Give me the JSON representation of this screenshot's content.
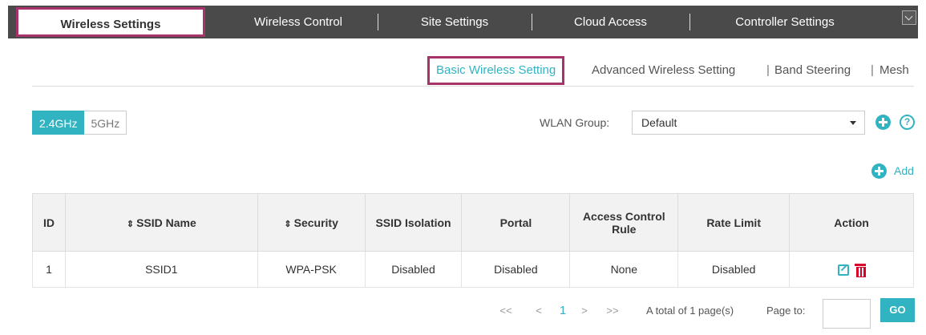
{
  "topnav": {
    "tabs": [
      {
        "label": "Wireless Settings",
        "active": true
      },
      {
        "label": "Wireless Control"
      },
      {
        "label": "Site Settings"
      },
      {
        "label": "Cloud Access"
      },
      {
        "label": "Controller Settings"
      }
    ]
  },
  "subnav": {
    "items": [
      {
        "label": "Basic Wireless Setting",
        "active": true
      },
      {
        "label": "Advanced Wireless Setting"
      },
      {
        "label": "Band Steering"
      },
      {
        "label": "Mesh"
      }
    ],
    "separator": "|"
  },
  "band": {
    "options": [
      "2.4GHz",
      "5GHz"
    ],
    "selected": "2.4GHz"
  },
  "wlan_group": {
    "label": "WLAN Group:",
    "value": "Default"
  },
  "add_label": "Add",
  "help_glyph": "?",
  "table": {
    "headers": {
      "id": "ID",
      "ssid": "SSID Name",
      "security": "Security",
      "isolation": "SSID Isolation",
      "portal": "Portal",
      "acl": "Access Control Rule",
      "rate": "Rate Limit",
      "action": "Action"
    },
    "sort_glyph": "⇕",
    "rows": [
      {
        "id": "1",
        "ssid": "SSID1",
        "security": "WPA-PSK",
        "isolation": "Disabled",
        "portal": "Disabled",
        "acl": "None",
        "rate": "Disabled"
      }
    ]
  },
  "pagination": {
    "first": "<<",
    "prev": "<",
    "current": "1",
    "next": ">",
    "last": ">>",
    "total_text": "A total of 1 page(s)",
    "page_to_label": "Page to:",
    "go_label": "GO"
  },
  "colors": {
    "accent": "#32b3c2",
    "highlight": "#a8336b",
    "nav_bg": "#4a4a4a",
    "delete": "#d9002b"
  }
}
